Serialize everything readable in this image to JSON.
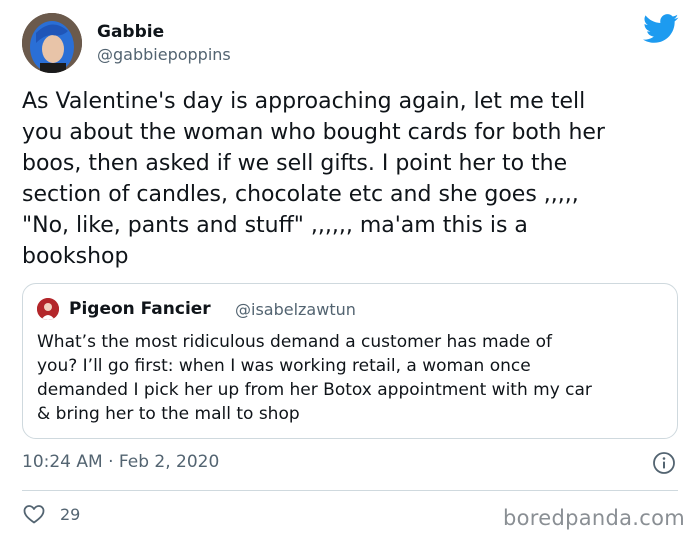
{
  "author": {
    "name": "Gabbie",
    "handle": "@gabbiepoppins"
  },
  "tweet": {
    "lines": [
      "As Valentine's day is approaching again, let me tell",
      "you about the woman who bought cards for both her",
      "boos, then asked if we sell gifts. I point her to the",
      "section of candles, chocolate etc and she goes ,,,,,",
      "\"No, like, pants and stuff\" ,,,,,, ma'am this is a",
      "bookshop"
    ]
  },
  "quoted_tweet": {
    "name": "Pigeon Fancier",
    "handle": "@isabelzawtun",
    "lines": [
      "What’s the most ridiculous demand a customer has made of",
      "you? I’ll go first: when I was working retail, a woman once",
      "demanded I pick her up from her Botox appointment with my car",
      "& bring her to the mall to shop"
    ]
  },
  "meta": {
    "timestamp": "10:24 AM · Feb 2, 2020",
    "like_count": "29"
  },
  "watermark": "boredpanda.com",
  "colors": {
    "twitter_blue": "#1d9bf0",
    "secondary_text": "#536471",
    "border": "#cfd9de"
  },
  "icons": {
    "brand": "twitter-bird-icon",
    "info": "info-icon",
    "like": "heart-icon"
  }
}
